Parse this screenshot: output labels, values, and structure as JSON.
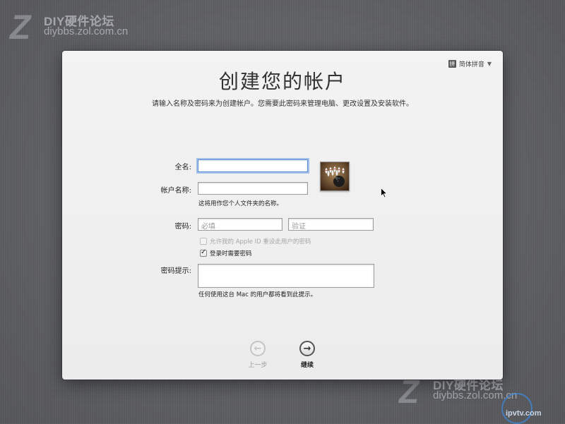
{
  "watermark": {
    "site_name": "DIY硬件论坛",
    "site_url": "diybbs.zol.com.cn",
    "logo_letter": "Z",
    "badge_text": "ipvtv.com"
  },
  "window": {
    "title": "创建您的帐户",
    "subtitle": "请输入名称及密码来为创建帐户。您需要此密码来管理电脑、更改设置及安装软件。",
    "input_method": {
      "badge": "拼",
      "label": "简体拼音"
    }
  },
  "form": {
    "full_name": {
      "label": "全名:",
      "value": ""
    },
    "account_name": {
      "label": "帐户名称:",
      "value": "",
      "hint": "这将用作您个人文件夹的名称。"
    },
    "password": {
      "label": "密码:",
      "placeholder": "必填",
      "verify_placeholder": "验证"
    },
    "allow_apple_id": {
      "label": "允许我的 Apple ID 重设此用户的密码",
      "checked": false,
      "disabled": true
    },
    "require_password_login": {
      "label": "登录时需要密码",
      "checked": true
    },
    "password_hint": {
      "label": "密码提示:",
      "value": "",
      "hint": "任何使用这台 Mac 的用户都将看到此提示。"
    }
  },
  "nav": {
    "back_label": "上一步",
    "continue_label": "继续"
  },
  "icons": {
    "avatar": "bowling-avatar-icon",
    "back": "arrow-left-circle-icon",
    "continue": "arrow-right-circle-icon",
    "cursor": "mouse-pointer-icon"
  }
}
